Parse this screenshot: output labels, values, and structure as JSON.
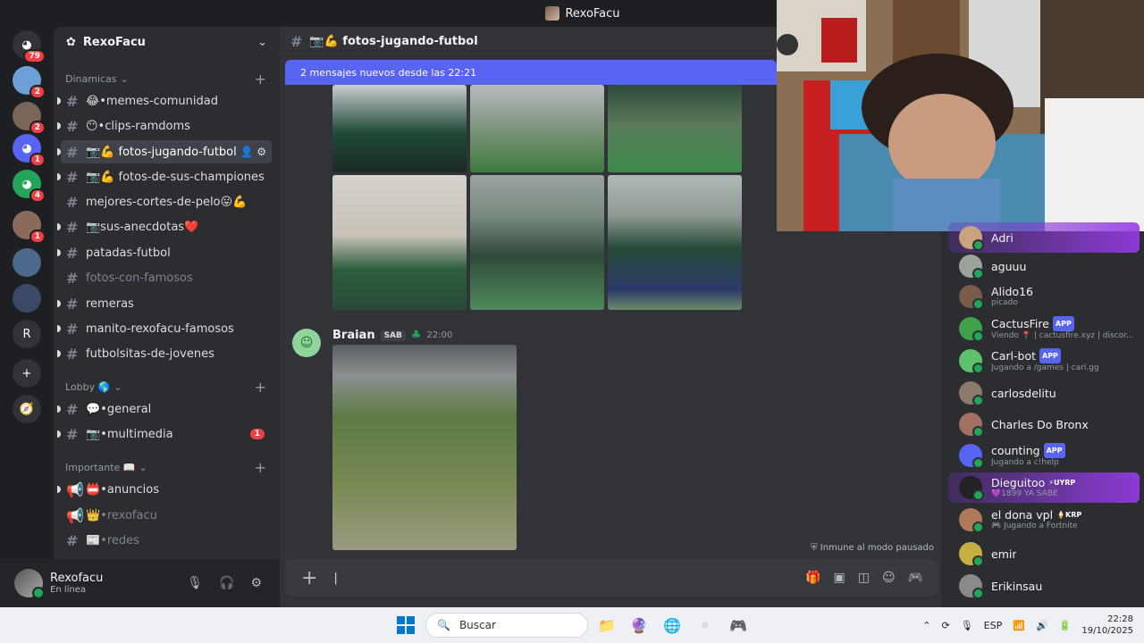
{
  "window": {
    "title": "RexoFacu"
  },
  "servers": [
    {
      "icon": "discord-icon",
      "badge": "79",
      "color": "#313338"
    },
    {
      "icon": "server-icon",
      "badge": "2",
      "color": "#6ea0d8"
    },
    {
      "icon": "server-icon",
      "badge": "2",
      "color": "#7a6658"
    },
    {
      "icon": "discord-icon",
      "badge": "1",
      "color": "#5865f2"
    },
    {
      "icon": "discord-icon",
      "badge": "4",
      "color": "#23a55a"
    },
    {
      "icon": "server-icon",
      "badge": "1",
      "color": "#8a6a5a"
    },
    {
      "icon": "server-icon",
      "badge": "",
      "color": "#4d6a8c"
    },
    {
      "icon": "server-icon",
      "badge": "",
      "color": "#3a4a66"
    },
    {
      "label": "R",
      "badge": "",
      "color": "#313338"
    }
  ],
  "sidebar": {
    "server_name": "RexoFacu",
    "categories": [
      {
        "name": "Dinamicas"
      },
      {
        "name": "Lobby 🌎"
      },
      {
        "name": "Importante 📖"
      }
    ],
    "channels": {
      "c1": "😂•memes-comunidad",
      "c2": "😶•clips-ramdoms",
      "c3": "📷💪 fotos-jugando-futbol",
      "c4": "📷💪 fotos-de-sus-championes",
      "c5": "mejores-cortes-de-pelo😛💪",
      "c6": "📷sus-anecdotas❤️",
      "c7": "patadas-futbol",
      "c8": "fotos-con-famosos",
      "c9": "remeras",
      "c10": "manito-rexofacu-famosos",
      "c11": "futbolsitas-de-jovenes",
      "c12": "💬•general",
      "c13": "📷•multimedia",
      "c13_badge": "1",
      "c14": "📛•anuncios",
      "c15": "👑•rexofacu",
      "c16": "📰•redes"
    }
  },
  "user": {
    "name": "Rexofacu",
    "status": "En línea"
  },
  "channel": {
    "title": "📷💪 fotos-jugando-futbol"
  },
  "banner": {
    "text": "2 mensajes nuevos desde las 22:21"
  },
  "message": {
    "author": "Braian",
    "tag": "SAB",
    "time": "22:00"
  },
  "paused": {
    "text": "Inmune al modo pausado"
  },
  "composer": {
    "placeholder": ""
  },
  "members": [
    {
      "name": "Adri",
      "status": "",
      "color": "#c9a27e",
      "hl": true
    },
    {
      "name": "aguuu",
      "status": "",
      "color": "#9aa29a"
    },
    {
      "name": "Alido16",
      "status": "picado",
      "color": "#7a5a4a"
    },
    {
      "name": "CactusFire",
      "status": "Viendo 📍 | cactusfire.xyz | discor...",
      "color": "#3fa24a",
      "app": "APP"
    },
    {
      "name": "Carl-bot",
      "status": "Jugando a /games | carl.gg",
      "color": "#5ec26a",
      "app": "APP"
    },
    {
      "name": "carlosdelitu",
      "status": "",
      "color": "#8a7a6a"
    },
    {
      "name": "Charles Do Bronx",
      "status": "",
      "color": "#a07060"
    },
    {
      "name": "counting",
      "status": "Jugando a c!help",
      "color": "#5865f2",
      "app": "APP"
    },
    {
      "name": "Dieguitoo",
      "status": "💜1899 YA SABE",
      "color": "#222",
      "hl": true,
      "tag": "⚡UYRP"
    },
    {
      "name": "el dona vpl",
      "status": "🎮 Jugando a Fortnite",
      "color": "#b07a5a",
      "tag": "🍦KRP"
    },
    {
      "name": "emir",
      "status": "",
      "color": "#c8b040"
    },
    {
      "name": "Erikinsau",
      "status": "",
      "color": "#8a8a8a"
    }
  ],
  "taskbar": {
    "search": "Buscar",
    "lang": "ESP",
    "time": "22:28",
    "date": "19/10/2025"
  }
}
